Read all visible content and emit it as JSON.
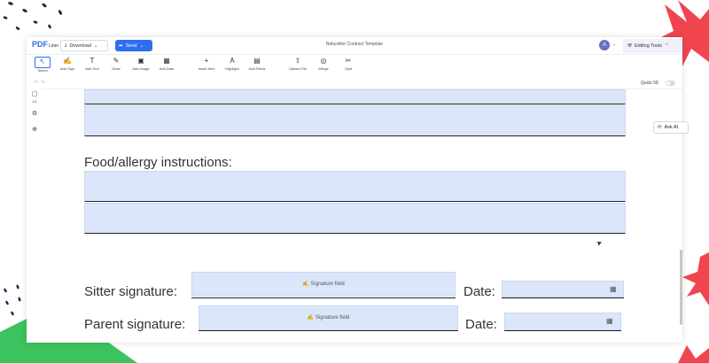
{
  "app": {
    "logo": "PDF",
    "logo_sub": "Liner",
    "download_label": "Download",
    "send_label": "Send",
    "document_title": "Babysitter Contract Template",
    "avatar_initial": "A",
    "editing_tools_label": "Editing Tools"
  },
  "toolbar": {
    "tools": [
      {
        "label": "Select",
        "icon": "↖"
      },
      {
        "label": "Add Sign",
        "icon": "✍"
      },
      {
        "label": "Add Text",
        "icon": "T"
      },
      {
        "label": "Draw",
        "icon": "✎"
      },
      {
        "label": "Add Image",
        "icon": "▣"
      },
      {
        "label": "Add Date",
        "icon": "▦"
      },
      {
        "label": "Insert item",
        "icon": "+"
      },
      {
        "label": "Highlight",
        "icon": "A"
      },
      {
        "label": "Add Fields",
        "icon": "▤"
      },
      {
        "label": "Upload File",
        "icon": "⇧"
      },
      {
        "label": "Merge",
        "icon": "◎"
      },
      {
        "label": "Split",
        "icon": "✂"
      }
    ]
  },
  "subbar": {
    "quick_label": "Quick 58"
  },
  "sidebar": {
    "page_count": "1/1"
  },
  "ask_ai_label": "Ask AI",
  "document": {
    "food_label": "Food/allergy instructions:",
    "sitter_signature_label": "Sitter signature:",
    "parent_signature_label": "Parent signature:",
    "date_label": "Date:",
    "signature_field_text": "Signature field"
  },
  "colors": {
    "accent": "#2f6cf0",
    "field_fill": "#dbe6fb",
    "deco_red": "#f0454f",
    "deco_green": "#3cc25f",
    "deco_navy": "#1b2a52"
  }
}
